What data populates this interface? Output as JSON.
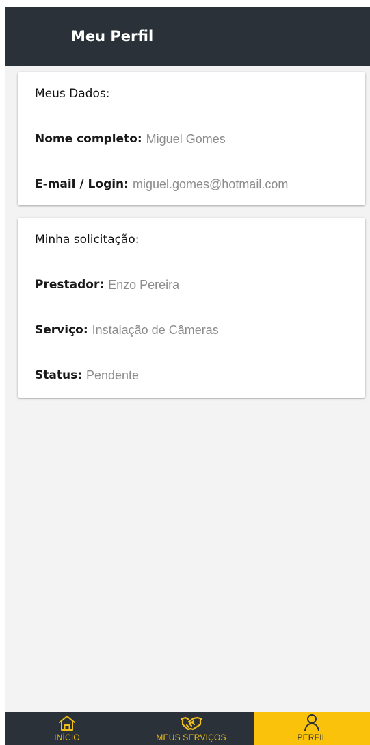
{
  "header": {
    "title": "Meu Perfil"
  },
  "my_data_card": {
    "title": "Meus Dados:",
    "fields": [
      {
        "label": "Nome completo:",
        "value": "Miguel Gomes"
      },
      {
        "label": "E-mail / Login:",
        "value": "miguel.gomes@hotmail.com"
      }
    ]
  },
  "request_card": {
    "title": "Minha solicitação:",
    "fields": [
      {
        "label": "Prestador:",
        "value": "Enzo Pereira"
      },
      {
        "label": "Serviço:",
        "value": "Instalação de Câmeras"
      },
      {
        "label": "Status:",
        "value": "Pendente"
      }
    ]
  },
  "bottom_nav": {
    "items": [
      {
        "label": "INÍCIO",
        "icon": "home-icon",
        "active": false
      },
      {
        "label": "MEUS SERVIÇOS",
        "icon": "handshake-icon",
        "active": false
      },
      {
        "label": "PERFIL",
        "icon": "user-icon",
        "active": true
      }
    ]
  },
  "colors": {
    "app_bar": "#2a3138",
    "accent": "#fbc20c",
    "background": "#f3f3f3",
    "value_text": "#8c8c8c"
  }
}
